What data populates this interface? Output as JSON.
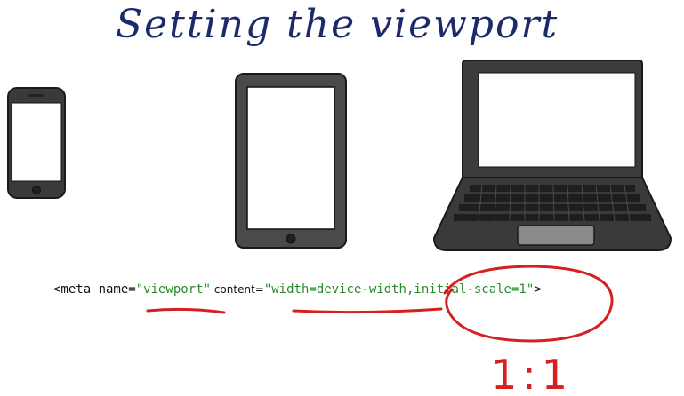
{
  "title": "Setting the viewport",
  "code": {
    "open": "<meta name=",
    "name_value": "\"viewport\"",
    "content_attr": " content=",
    "content_value_1": "\"width=device-width",
    "content_value_2": ",initial-scale=1\"",
    "close": ">"
  },
  "annotation": "1:1",
  "colors": {
    "title_ink": "#1c2a6b",
    "annotation_ink": "#d42020",
    "code_value": "#2a8a2a"
  },
  "icons": [
    "phone-icon",
    "tablet-icon",
    "laptop-icon"
  ]
}
